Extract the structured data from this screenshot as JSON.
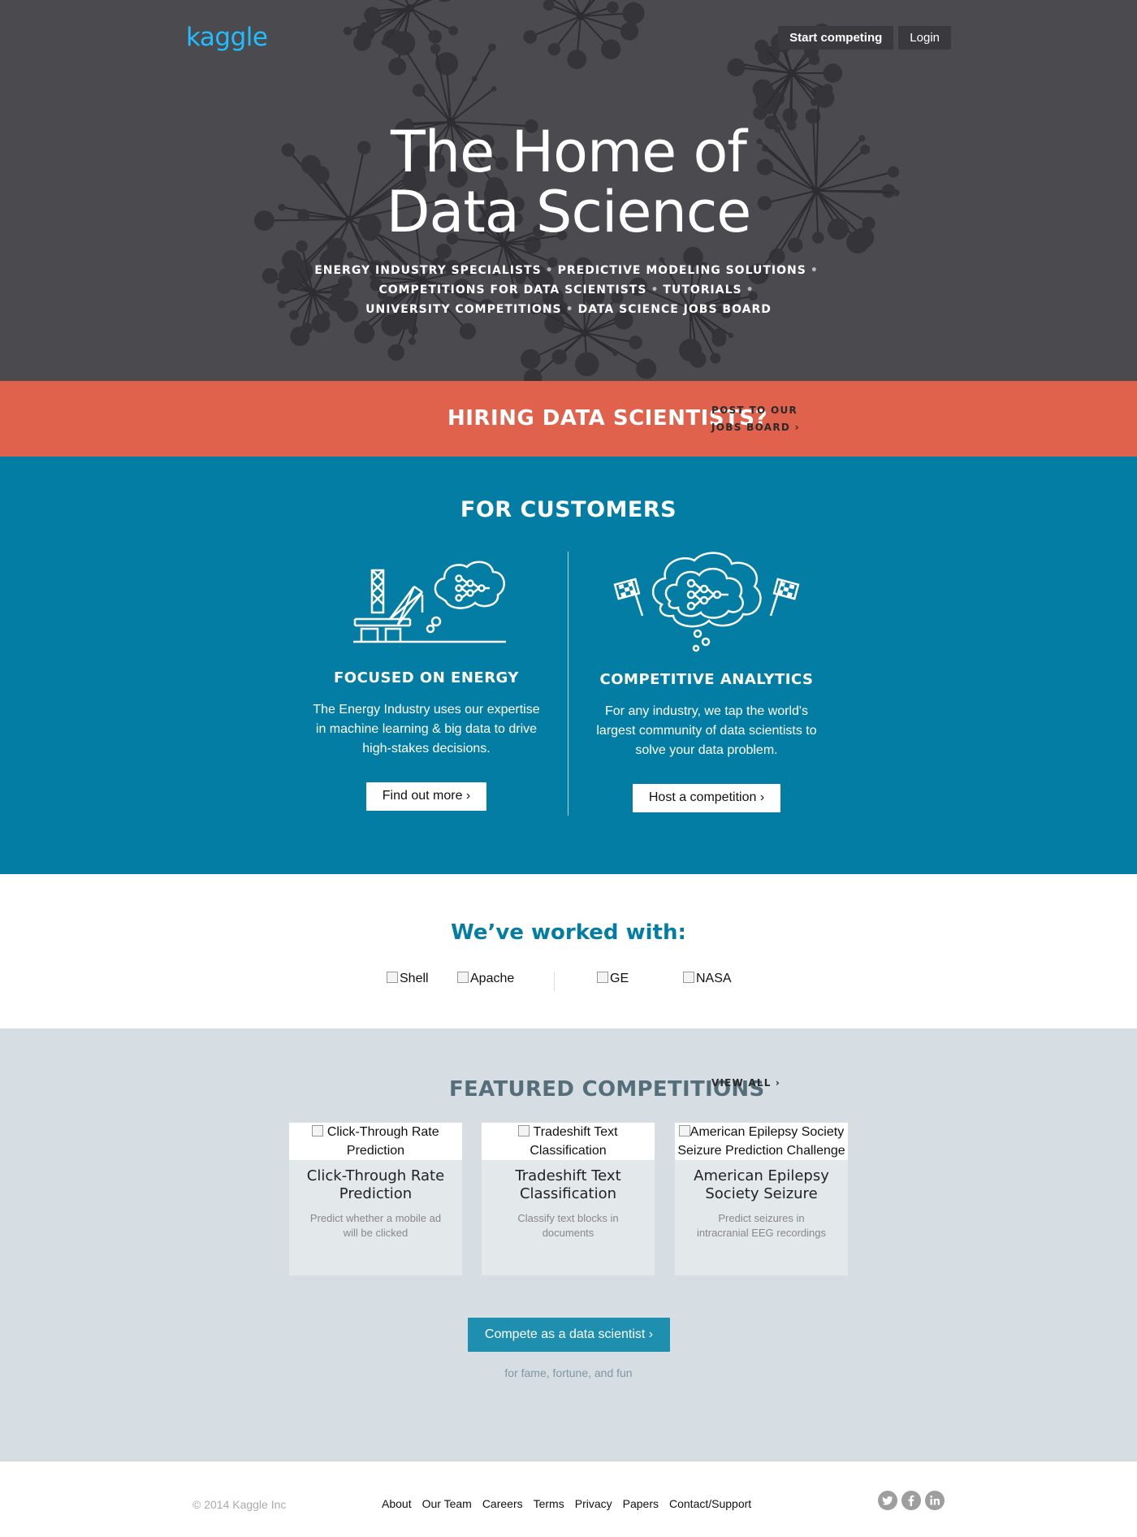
{
  "header": {
    "logo": "kaggle",
    "start_competing": "Start competing",
    "login": "Login"
  },
  "hero": {
    "title_line1": "The Home of",
    "title_line2": "Data Science",
    "sub_line1": [
      "ENERGY INDUSTRY SPECIALISTS",
      "PREDICTIVE MODELING SOLUTIONS"
    ],
    "sub_line2": [
      "COMPETITIONS FOR DATA SCIENTISTS",
      "TUTORIALS"
    ],
    "sub_line3": [
      "UNIVERSITY COMPETITIONS",
      "DATA SCIENCE JOBS BOARD"
    ],
    "bullet": "•"
  },
  "hiring": {
    "title": "HIRING DATA SCIENTISTS?",
    "link_line1": "POST TO OUR",
    "link_line2": "JOBS BOARD ›"
  },
  "customers": {
    "heading": "FOR CUSTOMERS",
    "energy": {
      "icon": "oil-rig-brain-icon",
      "title": "FOCUSED ON ENERGY",
      "text": "The Energy Industry uses our expertise in machine learning & big data to drive high-stakes decisions.",
      "button": "Find out more ›"
    },
    "analytics": {
      "icon": "brain-flags-icon",
      "title": "COMPETITIVE ANALYTICS",
      "text": "For any industry, we tap the world's largest community of data scientists to solve your data problem.",
      "button": "Host a competition ›"
    }
  },
  "worked": {
    "heading": "We’ve worked with:",
    "logos": [
      "Shell",
      "Apache",
      "GE",
      "NASA"
    ]
  },
  "featured": {
    "heading": "FEATURED COMPETITIONS",
    "view_all": "VIEW ALL ›",
    "cards": [
      {
        "img_alt": "Click-Through Rate Prediction",
        "title": "Click-Through Rate Prediction",
        "desc": "Predict whether a mobile ad will be clicked"
      },
      {
        "img_alt": "Tradeshift Text Classification",
        "title": "Tradeshift Text Classification",
        "desc": "Classify text blocks in documents"
      },
      {
        "img_alt": "American Epilepsy Society Seizure Prediction Challenge",
        "title": "American Epilepsy Society Seizure",
        "desc": "Predict seizures in intracranial EEG recordings"
      }
    ],
    "compete_button": "Compete as a data scientist ›",
    "compete_sub": "for fame, fortune, and fun"
  },
  "footer": {
    "copyright": "© 2014 Kaggle Inc",
    "links": [
      "About",
      "Our Team",
      "Careers",
      "Terms",
      "Privacy",
      "Papers",
      "Contact/Support"
    ],
    "socials": [
      "twitter-icon",
      "facebook-icon",
      "linkedin-icon"
    ]
  },
  "colors": {
    "hero_bg": "#4a4a4f",
    "brand": "#20beff",
    "hiring_bg": "#e1624c",
    "customers_bg": "#037da3",
    "featured_bg": "#d7dee3",
    "compete_button": "#1f8fb0"
  }
}
